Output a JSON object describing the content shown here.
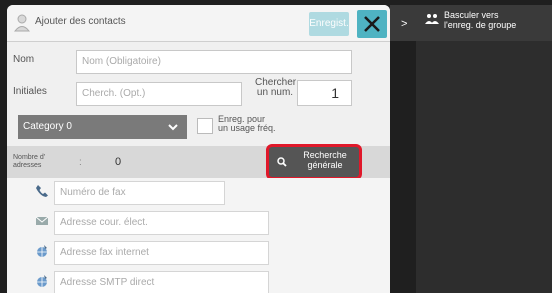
{
  "header": {
    "title": "Ajouter des contacts",
    "register_label": "Enregist.",
    "close_icon": "close-icon"
  },
  "form": {
    "name_label": "Nom",
    "name_placeholder": "Nom (Obligatoire)",
    "initials_label": "Initiales",
    "initials_placeholder": "Cherch. (Opt.)",
    "search_num_label_1": "Chercher",
    "search_num_label_2": "un num.",
    "search_num_value": "1",
    "category_value": "Category 0",
    "frequent_label_1": "Enreg. pour",
    "frequent_label_2": "un usage fréq."
  },
  "count": {
    "label_1": "Nombre d'",
    "label_2": "adresses",
    "separator": ":",
    "value": "0",
    "search_button_1": "Recherche",
    "search_button_2": "générale"
  },
  "contacts": [
    {
      "icon": "fax-icon",
      "placeholder": "Numéro de fax"
    },
    {
      "icon": "email-icon",
      "placeholder": "Adresse cour. élect."
    },
    {
      "icon": "internet-fax-icon",
      "placeholder": "Adresse fax internet"
    },
    {
      "icon": "smtp-icon",
      "placeholder": "Adresse SMTP direct"
    }
  ],
  "right": {
    "label_1": "Basculer vers",
    "label_2": "l'enreg. de groupe"
  },
  "colors": {
    "accent": "#4fb3c2",
    "highlight": "#e0182a"
  }
}
